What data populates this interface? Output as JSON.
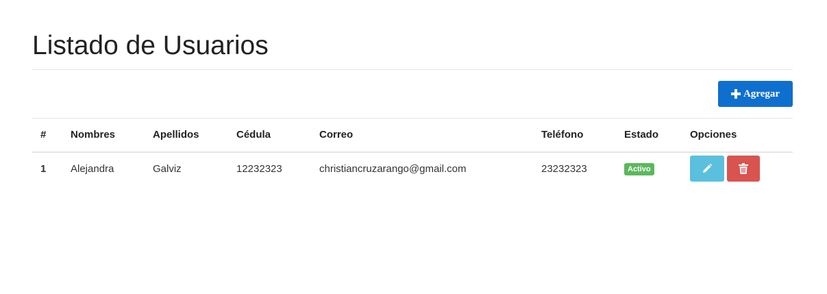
{
  "page": {
    "title": "Listado de Usuarios"
  },
  "toolbar": {
    "add_label": "Agregar",
    "add_icon": "plus-icon"
  },
  "table": {
    "headers": {
      "num": "#",
      "nombres": "Nombres",
      "apellidos": "Apellidos",
      "cedula": "Cédula",
      "correo": "Correo",
      "telefono": "Teléfono",
      "estado": "Estado",
      "opciones": "Opciones"
    },
    "rows": [
      {
        "num": "1",
        "nombres": "Alejandra",
        "apellidos": "Galviz",
        "cedula": "12232323",
        "correo": "christiancruzarango@gmail.com",
        "telefono": "23232323",
        "estado": "Activo",
        "edit_icon": "pencil-icon",
        "delete_icon": "trash-icon"
      }
    ]
  },
  "colors": {
    "primary": "#0f6fcf",
    "info": "#5bc0de",
    "danger": "#d9534f",
    "success": "#5cb85c"
  }
}
